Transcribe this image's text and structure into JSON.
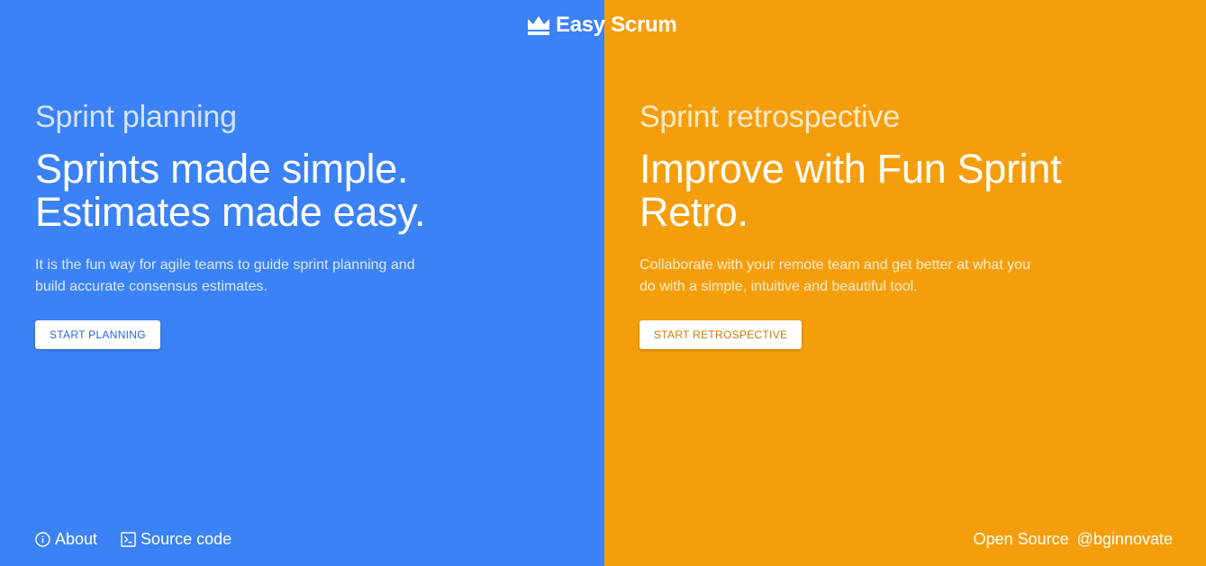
{
  "brand": {
    "name": "Easy Scrum",
    "icon": "crown-icon"
  },
  "planning": {
    "eyebrow": "Sprint planning",
    "headline_line1": "Sprints made simple.",
    "headline_line2": "Estimates made easy.",
    "description_line1": "It is the fun way for agile teams to guide sprint planning and",
    "description_line2": "build accurate consensus estimates.",
    "button_label": "START PLANNING",
    "color": "#3b82f6"
  },
  "retro": {
    "eyebrow": "Sprint retrospective",
    "headline_line1": "Improve with Fun Sprint",
    "headline_line2": "Retro.",
    "description_line1": "Collaborate with your remote team and get better at what you",
    "description_line2": "do with a simple, intuitive and beautiful tool.",
    "button_label": "START RETROSPECTIVE",
    "color": "#f59e0b"
  },
  "footer": {
    "about_label": "About",
    "about_icon": "info-icon",
    "source_label": "Source code",
    "source_icon": "terminal-icon",
    "open_source_label": "Open Source",
    "handle_label": "@bginnovate"
  }
}
